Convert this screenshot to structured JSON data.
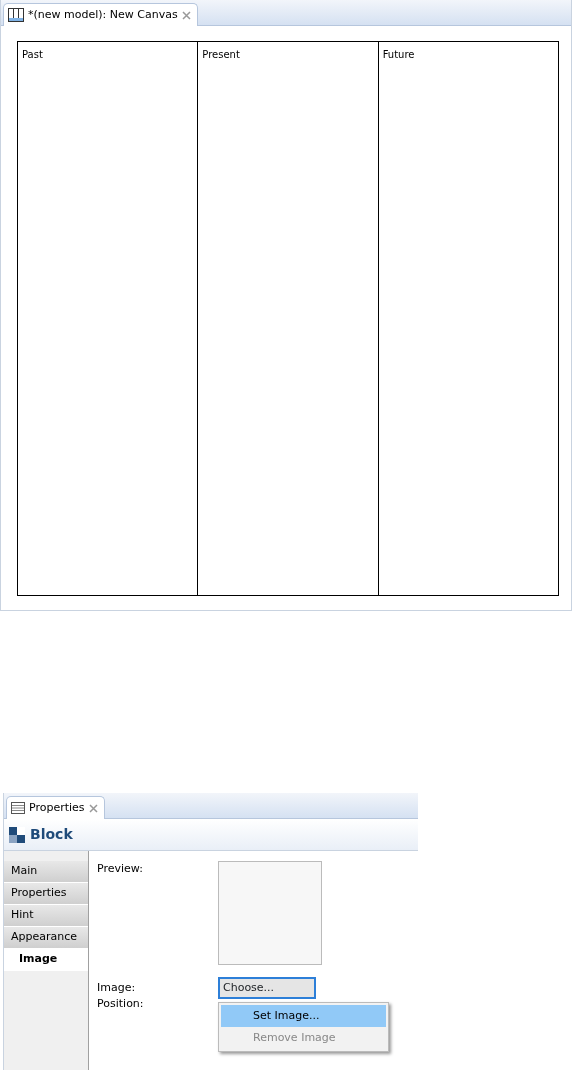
{
  "editor": {
    "tab": {
      "title": "*(new model): New Canvas",
      "selected": true
    },
    "columns": [
      {
        "title": "Past"
      },
      {
        "title": "Present"
      },
      {
        "title": "Future"
      }
    ]
  },
  "properties": {
    "tab": {
      "title": "Properties",
      "selected": true
    },
    "header": "Block",
    "sections": [
      {
        "label": "Main",
        "selected": false
      },
      {
        "label": "Properties",
        "selected": false
      },
      {
        "label": "Hint",
        "selected": false
      },
      {
        "label": "Appearance",
        "selected": false
      },
      {
        "label": "Image",
        "selected": true
      }
    ],
    "preview_label": "Preview:",
    "image_label": "Image:",
    "choose_button": "Choose...",
    "position_label": "Position:",
    "menu": [
      {
        "label": "Set Image...",
        "selected": true,
        "disabled": false
      },
      {
        "label": "Remove Image",
        "selected": false,
        "disabled": true
      }
    ]
  }
}
